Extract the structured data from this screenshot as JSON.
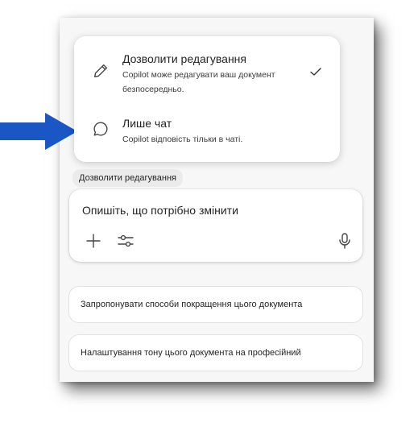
{
  "menu": {
    "items": [
      {
        "title": "Дозволити редагування",
        "desc": "Copilot може редагувати ваш документ безпосередньо.",
        "icon": "pencil-icon",
        "selected": true
      },
      {
        "title": "Лише чат",
        "desc": "Copilot відповість тільки в чаті.",
        "icon": "chat-bubble-icon",
        "selected": false
      }
    ]
  },
  "mode_label": "Дозволити редагування",
  "composer": {
    "prompt": "Опишіть, що потрібно змінити",
    "icons": [
      "plus-icon",
      "sliders-icon",
      "microphone-icon"
    ]
  },
  "suggestions": [
    "Запропонувати способи покращення цього документа",
    "Налаштування тону цього документа на професійний"
  ],
  "colors": {
    "arrow": "#1a56c4",
    "panel": "#f7f7f7",
    "card": "#ffffff"
  }
}
